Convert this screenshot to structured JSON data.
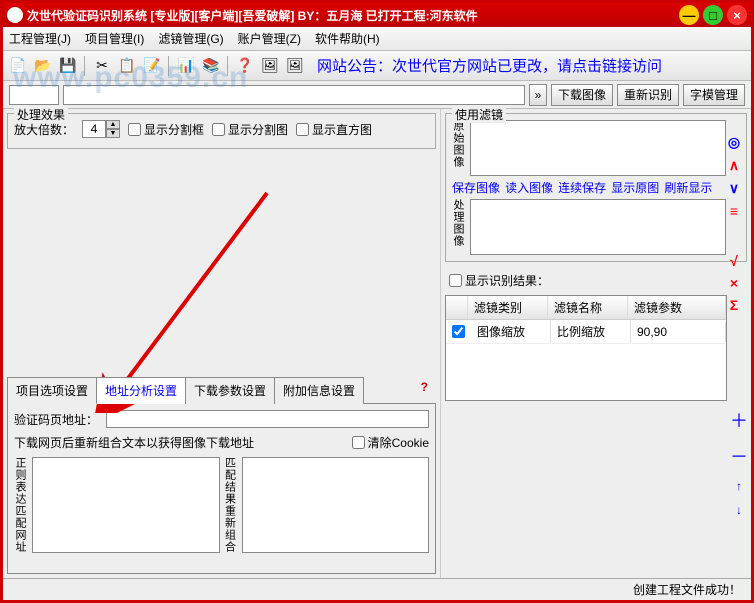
{
  "title": "次世代验证码识别系统 [专业版][客户端][吾爱破解]  BY：五月海 已打开工程:河东软件",
  "menu": {
    "m1": "工程管理(J)",
    "m2": "项目管理(I)",
    "m3": "滤镜管理(G)",
    "m4": "账户管理(Z)",
    "m5": "软件帮助(H)"
  },
  "announce": "网站公告：次世代官方网站已更改，请点击链接访问",
  "row2": {
    "go": "»",
    "dl": "下载图像",
    "reid": "重新识别",
    "font": "字模管理"
  },
  "left": {
    "effect_title": "处理效果",
    "zoom_label": "放大倍数：",
    "zoom_value": "4",
    "ck_splitbox": "显示分割框",
    "ck_splitimg": "显示分割图",
    "ck_histogram": "显示直方图",
    "tabs": {
      "t1": "项目选项设置",
      "t2": "地址分析设置",
      "t3": "下载参数设置",
      "t4": "附加信息设置"
    },
    "captcha_label": "验证码页地址：",
    "rebuild_label": "下载网页后重新组合文本以获得图像下载地址",
    "ck_cookie": "清除Cookie",
    "regex_label": "正则表达匹配网址",
    "match_label": "匹配结果重新组合"
  },
  "right": {
    "use_filter": "使用滤镜",
    "orig_label": "原始图像",
    "proc_label": "处理图像",
    "links": {
      "save": "保存图像",
      "load": "读入图像",
      "cont": "连续保存",
      "show": "显示原图",
      "refresh": "刷新显示"
    },
    "ck_show_result": "显示识别结果：",
    "cols": {
      "c1": "滤镜类别",
      "c2": "滤镜名称",
      "c3": "滤镜参数"
    },
    "row": {
      "cat": "图像缩放",
      "name": "比例缩放",
      "param": "90,90"
    },
    "side1": {
      "a": "◎",
      "b": "∧",
      "c": "∨",
      "d": "≡"
    },
    "side15": {
      "a": "√",
      "b": "×",
      "c": "Σ"
    },
    "side2": {
      "a": "＋",
      "b": "－",
      "c": "↑",
      "d": "↓"
    }
  },
  "status": "创建工程文件成功！",
  "watermark": "www.pc0359.cn"
}
